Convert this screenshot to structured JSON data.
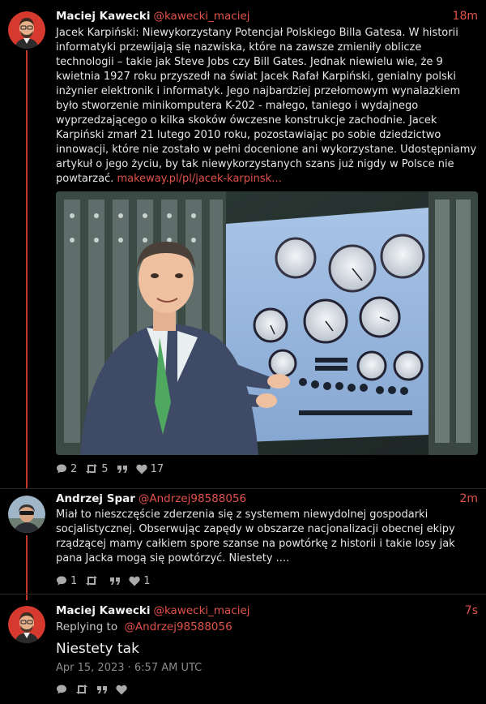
{
  "posts": [
    {
      "author": "Maciej Kawecki",
      "handle": "@kawecki_maciej",
      "time": "18m",
      "text": "Jacek Karpiński: Niewykorzystany Potencjał Polskiego Billa Gatesa. W historii informatyki przewijają się nazwiska, które na zawsze zmieniły oblicze technologii – takie jak Steve Jobs czy Bill Gates. Jednak niewielu wie, że 9 kwietnia 1927 roku przyszedł na świat Jacek Rafał Karpiński, genialny polski inżynier elektronik i informatyk. Jego najbardziej przełomowym wynalazkiem było stworzenie minikomputera K-202 - małego, taniego i wydajnego wyprzedzającego o kilka skoków ówczesne konstrukcje zachodnie. Jacek Karpiński zmarł 21 lutego 2010 roku, pozostawiając po sobie dziedzictwo innowacji, które nie zostało w pełni docenione ani wykorzystane. Udostępniamy artykuł o jego życiu, by tak niewykorzystanych szans już nigdy w Polsce nie powtarzać.",
      "link": "makeway.pl/pl/jacek-karpinsk…",
      "counts": {
        "replies": "2",
        "reposts": "5",
        "likes": "17"
      }
    },
    {
      "author": "Andrzej Spar",
      "handle": "@Andrzej98588056",
      "time": "2m",
      "text": "Miał to nieszczęście zderzenia się z systemem niewydolnej gospodarki socjalistycznej. Obserwując zapędy w obszarze nacjonalizacji obecnej ekipy rządzącej mamy całkiem spore szanse na powtórkę z historii i takie losy jak pana Jacka mogą się powtórzyć. Niestety ....",
      "counts": {
        "replies": "1",
        "reposts": "",
        "likes": "1"
      }
    },
    {
      "author": "Maciej Kawecki",
      "handle": "@kawecki_maciej",
      "time": "7s",
      "replying_prefix": "Replying to",
      "replying_to": "@Andrzej98588056",
      "text": "Niestety tak",
      "date": "Apr 15, 2023 · 6:57 AM UTC"
    }
  ],
  "colors": {
    "accent": "#e0514a",
    "thread_line": "#c0392b",
    "background": "#000000"
  },
  "icons": [
    "reply-icon",
    "repost-icon",
    "quote-icon",
    "heart-icon"
  ]
}
